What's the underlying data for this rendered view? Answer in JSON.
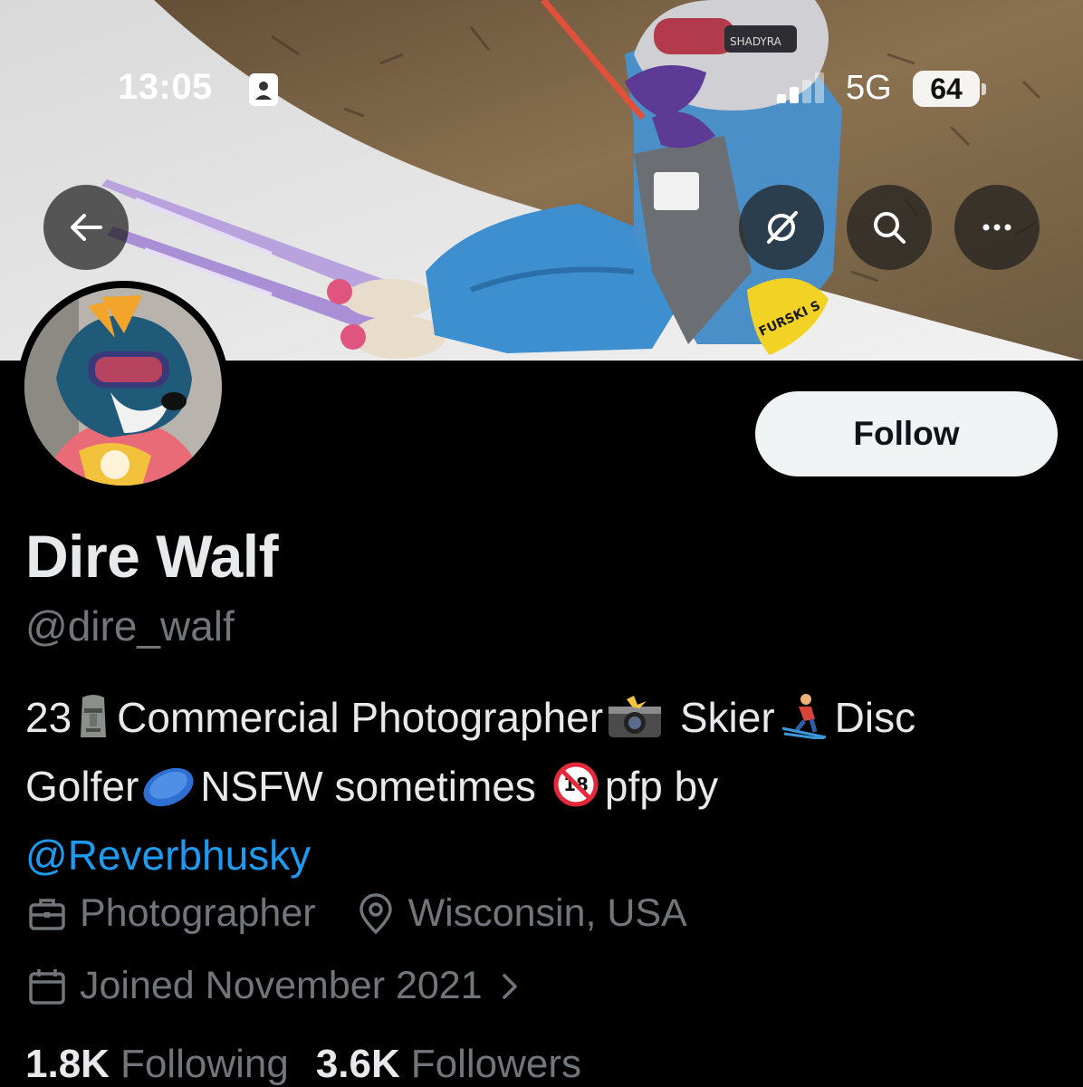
{
  "status_bar": {
    "time": "13:05",
    "network": "5G",
    "battery": "64"
  },
  "banner": {
    "goggle_text": "SHADYRA",
    "bandana_text": "FURSKI S"
  },
  "profile": {
    "follow_label": "Follow",
    "display_name": "Dire Walf",
    "handle": "@dire_walf",
    "bio": {
      "part1": "23",
      "part2": "Commercial Photographer",
      "part3": "Skier",
      "part4": "Disc",
      "part5": "Golfer",
      "part6": "NSFW sometimes",
      "part7": "pfp by",
      "mention": "@Reverbhusky"
    },
    "emojis": [
      "moai",
      "camera-flash",
      "skier",
      "flying-disc",
      "no-one-under-eighteen"
    ],
    "profession": "Photographer",
    "location": "Wisconsin, USA",
    "joined": "Joined November 2021",
    "following_count": "1.8K",
    "following_label": "Following",
    "followers_count": "3.6K",
    "followers_label": "Followers"
  },
  "colors": {
    "background": "#000000",
    "link": "#1d9bf0",
    "muted": "#71767b",
    "text": "#e7e9ea",
    "follow_bg": "#eff3f4"
  }
}
